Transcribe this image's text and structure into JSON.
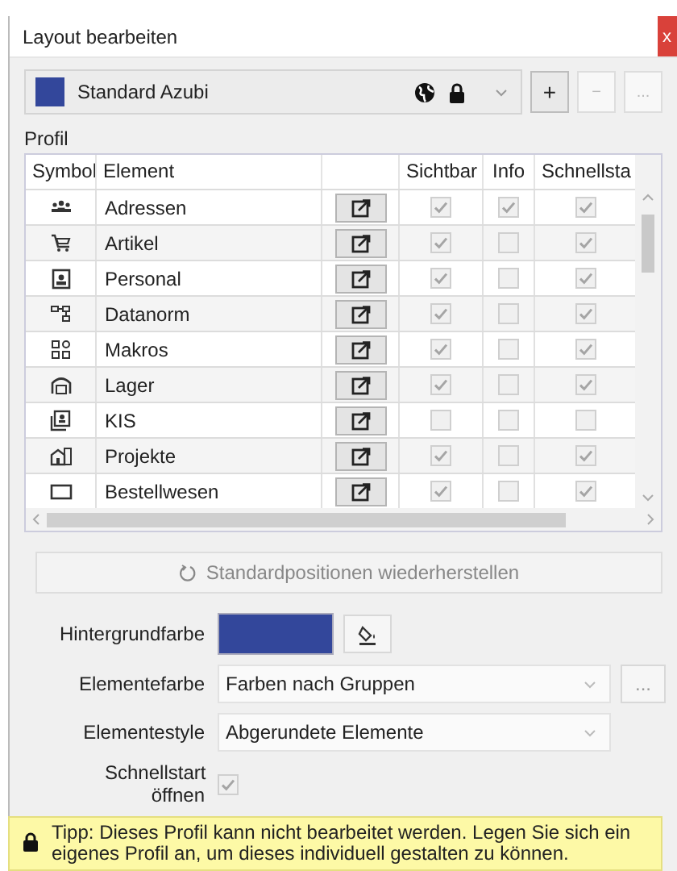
{
  "window": {
    "title": "Layout bearbeiten",
    "close": "x"
  },
  "profile_selector": {
    "value": "Standard Azubi",
    "color": "#33479b"
  },
  "profile_buttons": [
    {
      "label": "+",
      "disabled": false
    },
    {
      "label": "−",
      "disabled": true
    },
    {
      "label": "...",
      "disabled": true
    }
  ],
  "section_label": "Profil",
  "table": {
    "columns": [
      "Symbol",
      "Element",
      "Sichtbar",
      "Info",
      "Schnellsta"
    ],
    "rows": [
      {
        "element": "Adressen",
        "visible": true,
        "info": true,
        "quickstart": true
      },
      {
        "element": "Artikel",
        "visible": true,
        "info": false,
        "quickstart": true
      },
      {
        "element": "Personal",
        "visible": true,
        "info": false,
        "quickstart": true
      },
      {
        "element": "Datanorm",
        "visible": true,
        "info": false,
        "quickstart": true
      },
      {
        "element": "Makros",
        "visible": true,
        "info": false,
        "quickstart": true
      },
      {
        "element": "Lager",
        "visible": true,
        "info": false,
        "quickstart": true
      },
      {
        "element": "KIS",
        "visible": false,
        "info": false,
        "quickstart": false
      },
      {
        "element": "Projekte",
        "visible": true,
        "info": false,
        "quickstart": true
      },
      {
        "element": "Bestellwesen",
        "visible": true,
        "info": false,
        "quickstart": true
      }
    ]
  },
  "restore_button": {
    "label": "Standardpositionen wiederherstellen",
    "disabled": true
  },
  "settings": {
    "background_color": {
      "label": "Hintergrundfarbe",
      "color": "#33479b"
    },
    "element_color": {
      "label": "Elementefarbe",
      "value": "Farben nach Gruppen",
      "button": "..."
    },
    "element_style": {
      "label": "Elementestyle",
      "value": "Abgerundete Elemente"
    },
    "quickstart_open": {
      "label": "Schnellstart öffnen",
      "checked": true
    }
  },
  "tip": {
    "text": "Tipp: Dieses Profil kann nicht bearbeitet werden. Legen Sie sich ein eigenes Profil an, um dieses individuell gestalten zu können."
  }
}
